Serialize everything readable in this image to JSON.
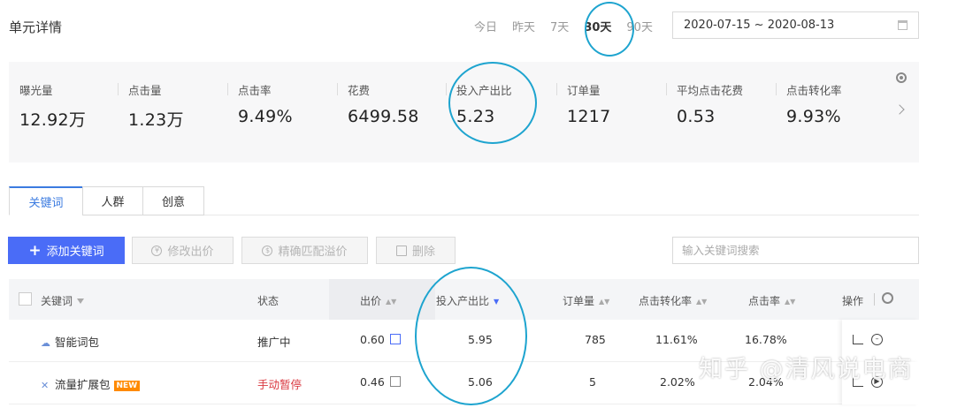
{
  "header": {
    "title": "单元详情",
    "ranges": [
      "今日",
      "昨天",
      "7天",
      "30天",
      "90天"
    ],
    "date_range": "2020-07-15 ~ 2020-08-13"
  },
  "metrics": [
    {
      "label": "曝光量",
      "value": "12.92万"
    },
    {
      "label": "点击量",
      "value": "1.23万"
    },
    {
      "label": "点击率",
      "value": "9.49%"
    },
    {
      "label": "花费",
      "value": "6499.58"
    },
    {
      "label": "投入产出比",
      "value": "5.23"
    },
    {
      "label": "订单量",
      "value": "1217"
    },
    {
      "label": "平均点击花费",
      "value": "0.53"
    },
    {
      "label": "点击转化率",
      "value": "9.93%"
    }
  ],
  "tabs": [
    "关键词",
    "人群",
    "创意"
  ],
  "toolbar": {
    "add_keyword": "添加关键词",
    "modify_bid": "修改出价",
    "exact_match_premium": "精确匹配溢价",
    "delete": "删除",
    "search_placeholder": "输入关键词搜索"
  },
  "table": {
    "headers": {
      "keyword": "关键词",
      "status": "状态",
      "bid": "出价",
      "roi": "投入产出比",
      "orders": "订单量",
      "conv_rate": "点击转化率",
      "ctr": "点击率",
      "actions": "操作"
    },
    "rows": [
      {
        "keyword": "智能词包",
        "status": "推广中",
        "bid": "0.60",
        "roi": "5.95",
        "orders": "785",
        "conv_rate": "11.61%",
        "ctr": "16.78%"
      },
      {
        "keyword": "流量扩展包",
        "badge": "NEW",
        "status": "手动暂停",
        "bid": "0.46",
        "roi": "5.06",
        "orders": "5",
        "conv_rate": "2.02%",
        "ctr": "2.04%"
      }
    ]
  },
  "watermark": "知乎 @清风说电商",
  "colors": {
    "primary": "#4a6cf7",
    "annotation": "#1ea4cf",
    "paused": "#d9363e"
  }
}
